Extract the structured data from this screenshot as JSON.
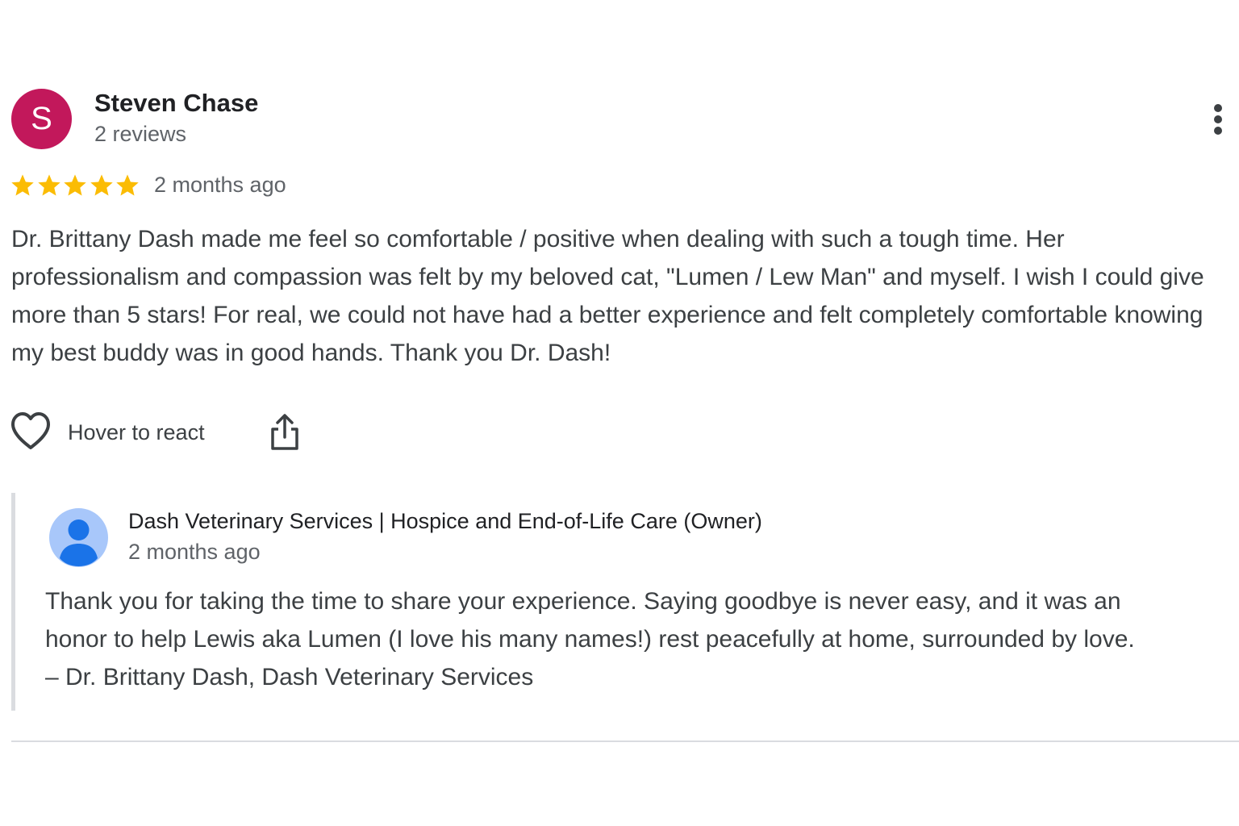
{
  "review": {
    "reviewer": {
      "initial": "S",
      "name": "Steven Chase",
      "review_count": "2 reviews",
      "avatar_color": "#c2185b"
    },
    "rating": 5,
    "rating_max": 5,
    "star_color": "#fbbc04",
    "date": "2 months ago",
    "text": "Dr. Brittany Dash made me feel so comfortable / positive when dealing with such a tough time. Her professionalism and compassion was felt by my beloved cat, \"Lumen / Lew Man\" and myself. I wish I could give more than 5 stars! For real, we could not have had a better experience and felt completely comfortable knowing my best buddy was in good hands. Thank you Dr. Dash!",
    "actions": {
      "react_icon": "heart-icon",
      "react_label": "Hover to react",
      "share_icon": "share-icon",
      "more_icon": "more-vertical-icon"
    }
  },
  "owner_response": {
    "avatar_icon": "person-avatar-icon",
    "name": "Dash Veterinary Services | Hospice and End-of-Life Care (Owner)",
    "date": "2 months ago",
    "text_lines": [
      "Thank you for taking the time to share your experience. Saying goodbye is never easy, and it was an",
      "honor to help Lewis aka Lumen (I love his many names!) rest peacefully at home, surrounded by love.",
      "– Dr. Brittany Dash, Dash Veterinary Services"
    ]
  }
}
